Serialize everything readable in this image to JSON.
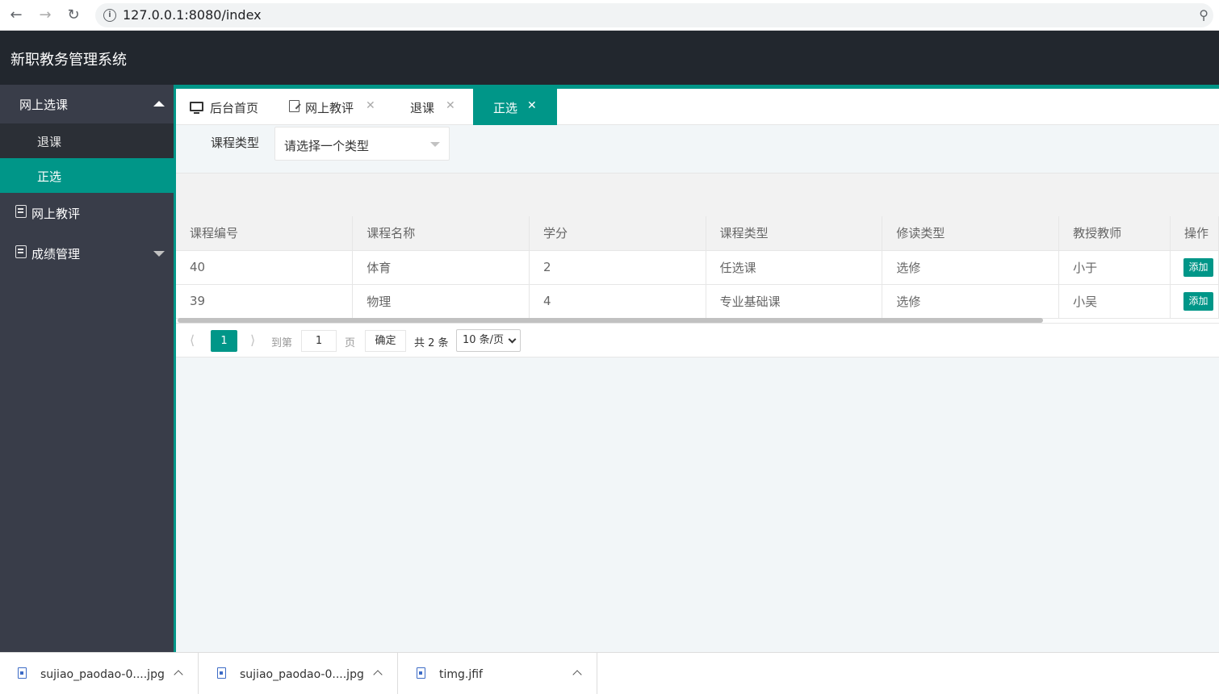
{
  "browser": {
    "url": "127.0.0.1:8080/index",
    "back_icon": "arrow-left-icon",
    "forward_icon": "arrow-right-icon",
    "reload_icon": "reload-icon",
    "key_icon": "key-icon"
  },
  "app": {
    "title": "新职教务管理系统",
    "accent_color": "#009688"
  },
  "sidebar": {
    "group_online": {
      "label": "网上选课"
    },
    "sub_items": [
      {
        "label": "退课"
      },
      {
        "label": "正选"
      }
    ],
    "row_eval": {
      "label": "网上教评"
    },
    "row_grades": {
      "label": "成绩管理"
    }
  },
  "tabs": [
    {
      "label": "后台首页"
    },
    {
      "label": "网上教评"
    },
    {
      "label": "退课"
    },
    {
      "label": "正选"
    }
  ],
  "filter": {
    "label": "课程类型",
    "value": "请选择一个类型"
  },
  "table": {
    "headers": [
      "课程编号",
      "课程名称",
      "学分",
      "课程类型",
      "修读类型",
      "教授教师",
      "操作"
    ],
    "rows": [
      {
        "id": "40",
        "name": "体育",
        "credit": "2",
        "type": "任选课",
        "study": "选修",
        "teacher": "小于",
        "action": "添加"
      },
      {
        "id": "39",
        "name": "物理",
        "credit": "4",
        "type": "专业基础课",
        "study": "选修",
        "teacher": "小吴",
        "action": "添加"
      }
    ]
  },
  "pager": {
    "current": "1",
    "goto_label": "到第",
    "page_value": "1",
    "page_unit": "页",
    "confirm": "确定",
    "total": "共 2 条",
    "page_size": "10 条/页"
  },
  "downloads": [
    {
      "name": "sujiao_paodao-0....jpg"
    },
    {
      "name": "sujiao_paodao-0....jpg"
    },
    {
      "name": "timg.jfif"
    }
  ]
}
